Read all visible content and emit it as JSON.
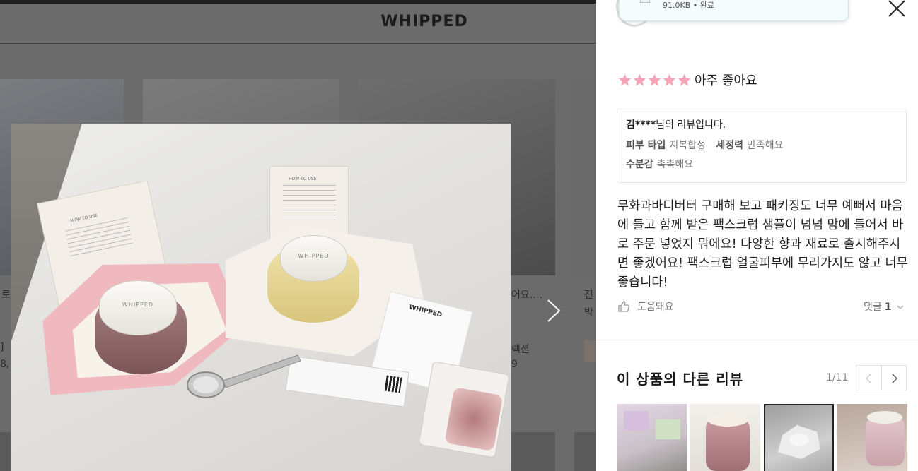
{
  "background": {
    "brand": "WHIPPED",
    "fragments": {
      "left_text_1": "로",
      "left_text_2": "]",
      "left_text_3": "8,",
      "mid_text_1": "어요.…",
      "mid_text_2": "렉션",
      "mid_text_3": "9",
      "right_text_1": "진",
      "right_text_2": "박"
    }
  },
  "photo": {
    "jar_label": "WHIPPED",
    "sachet_label": "WHIPPED",
    "box_title": "HOW TO USE"
  },
  "panel": {
    "upload": {
      "meta": "91.0KB • 완료"
    },
    "rating": {
      "stars": 5,
      "max": 5,
      "text": "아주 좋아요",
      "star_color": "#f5a3b6"
    },
    "reviewer": {
      "name": "김****",
      "suffix": "님의 리뷰입니다.",
      "attrs": [
        {
          "key": "피부 타입",
          "value": "지복합성"
        },
        {
          "key": "세정력",
          "value": "만족해요"
        },
        {
          "key": "수분감",
          "value": "촉촉해요"
        }
      ]
    },
    "review_text": "무화과바디버터 구매해 보고 패키징도 너무 예뻐서 마음에 들고 함께 받은 팩스크럽 샘플이 넘넘 맘에 들어서 바로 주문 넣었지 뭐에요! 다양한 향과 재료로 출시해주시면 좋겠어요! 팩스크럽 얼굴피부에 무리가지도 않고 너무 좋습니다!",
    "helpful_label": "도움돼요",
    "comments_label": "댓글",
    "comments_count": "1",
    "other": {
      "title": "이 상품의 다른 리뷰",
      "pager": "1/11"
    }
  }
}
